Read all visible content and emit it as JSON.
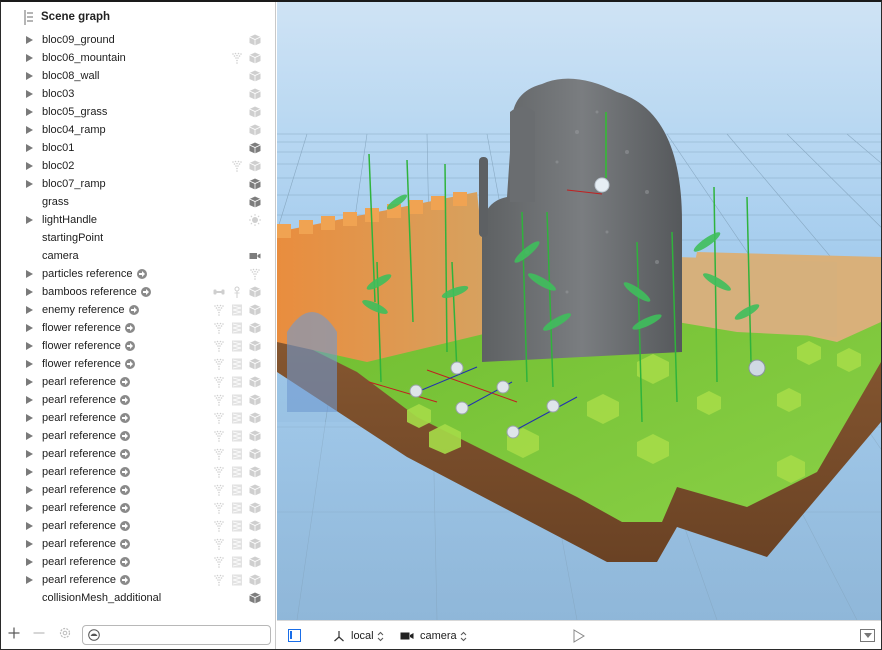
{
  "sidebar": {
    "title": "Scene graph",
    "nodes": [
      {
        "label": "bloc09_ground",
        "expandable": true,
        "reference": false,
        "icons": [
          "geometry-icon"
        ],
        "highlight": false
      },
      {
        "label": "bloc06_mountain",
        "expandable": true,
        "reference": false,
        "icons": [
          "particle-emitter-icon",
          "geometry-icon"
        ],
        "highlight": false
      },
      {
        "label": "bloc08_wall",
        "expandable": true,
        "reference": false,
        "icons": [
          "geometry-icon"
        ],
        "highlight": false
      },
      {
        "label": "bloc03",
        "expandable": true,
        "reference": false,
        "icons": [
          "geometry-icon"
        ],
        "highlight": false
      },
      {
        "label": "bloc05_grass",
        "expandable": true,
        "reference": false,
        "icons": [
          "geometry-icon"
        ],
        "highlight": false
      },
      {
        "label": "bloc04_ramp",
        "expandable": true,
        "reference": false,
        "icons": [
          "geometry-icon"
        ],
        "highlight": false
      },
      {
        "label": "bloc01",
        "expandable": true,
        "reference": false,
        "icons": [
          "geometry-icon"
        ],
        "highlight": true
      },
      {
        "label": "bloc02",
        "expandable": true,
        "reference": false,
        "icons": [
          "particle-emitter-icon",
          "geometry-icon"
        ],
        "highlight": false
      },
      {
        "label": "bloc07_ramp",
        "expandable": true,
        "reference": false,
        "icons": [
          "geometry-icon"
        ],
        "highlight": true
      },
      {
        "label": "grass",
        "expandable": false,
        "reference": false,
        "icons": [
          "geometry-icon"
        ],
        "highlight": true
      },
      {
        "label": "lightHandle",
        "expandable": true,
        "reference": false,
        "icons": [
          "light-icon"
        ],
        "highlight": false
      },
      {
        "label": "startingPoint",
        "expandable": false,
        "reference": false,
        "icons": [],
        "highlight": false
      },
      {
        "label": "camera",
        "expandable": false,
        "reference": false,
        "icons": [
          "camera-icon"
        ],
        "highlight": true
      },
      {
        "label": "particles reference",
        "expandable": true,
        "reference": true,
        "icons": [
          "particle-emitter-icon"
        ],
        "highlight": false
      },
      {
        "label": "bamboos reference",
        "expandable": true,
        "reference": true,
        "icons": [
          "physics-joint-icon",
          "field-icon",
          "geometry-icon"
        ],
        "highlight": false
      },
      {
        "label": "enemy reference",
        "expandable": true,
        "reference": true,
        "icons": [
          "particle-emitter-icon",
          "animation-icon",
          "geometry-icon"
        ],
        "highlight": false
      },
      {
        "label": "flower reference",
        "expandable": true,
        "reference": true,
        "icons": [
          "particle-emitter-icon",
          "animation-icon",
          "geometry-icon"
        ],
        "highlight": false
      },
      {
        "label": "flower reference",
        "expandable": true,
        "reference": true,
        "icons": [
          "particle-emitter-icon",
          "animation-icon",
          "geometry-icon"
        ],
        "highlight": false
      },
      {
        "label": "flower reference",
        "expandable": true,
        "reference": true,
        "icons": [
          "particle-emitter-icon",
          "animation-icon",
          "geometry-icon"
        ],
        "highlight": false
      },
      {
        "label": "pearl reference",
        "expandable": true,
        "reference": true,
        "icons": [
          "particle-emitter-icon",
          "animation-icon",
          "geometry-icon"
        ],
        "highlight": false
      },
      {
        "label": "pearl reference",
        "expandable": true,
        "reference": true,
        "icons": [
          "particle-emitter-icon",
          "animation-icon",
          "geometry-icon"
        ],
        "highlight": false
      },
      {
        "label": "pearl reference",
        "expandable": true,
        "reference": true,
        "icons": [
          "particle-emitter-icon",
          "animation-icon",
          "geometry-icon"
        ],
        "highlight": false
      },
      {
        "label": "pearl reference",
        "expandable": true,
        "reference": true,
        "icons": [
          "particle-emitter-icon",
          "animation-icon",
          "geometry-icon"
        ],
        "highlight": false
      },
      {
        "label": "pearl reference",
        "expandable": true,
        "reference": true,
        "icons": [
          "particle-emitter-icon",
          "animation-icon",
          "geometry-icon"
        ],
        "highlight": false
      },
      {
        "label": "pearl reference",
        "expandable": true,
        "reference": true,
        "icons": [
          "particle-emitter-icon",
          "animation-icon",
          "geometry-icon"
        ],
        "highlight": false
      },
      {
        "label": "pearl reference",
        "expandable": true,
        "reference": true,
        "icons": [
          "particle-emitter-icon",
          "animation-icon",
          "geometry-icon"
        ],
        "highlight": false
      },
      {
        "label": "pearl reference",
        "expandable": true,
        "reference": true,
        "icons": [
          "particle-emitter-icon",
          "animation-icon",
          "geometry-icon"
        ],
        "highlight": false
      },
      {
        "label": "pearl reference",
        "expandable": true,
        "reference": true,
        "icons": [
          "particle-emitter-icon",
          "animation-icon",
          "geometry-icon"
        ],
        "highlight": false
      },
      {
        "label": "pearl reference",
        "expandable": true,
        "reference": true,
        "icons": [
          "particle-emitter-icon",
          "animation-icon",
          "geometry-icon"
        ],
        "highlight": false
      },
      {
        "label": "pearl reference",
        "expandable": true,
        "reference": true,
        "icons": [
          "particle-emitter-icon",
          "animation-icon",
          "geometry-icon"
        ],
        "highlight": false
      },
      {
        "label": "pearl reference",
        "expandable": true,
        "reference": true,
        "icons": [
          "particle-emitter-icon",
          "animation-icon",
          "geometry-icon"
        ],
        "highlight": false
      },
      {
        "label": "collisionMesh_additional",
        "expandable": false,
        "reference": false,
        "icons": [
          "geometry-icon"
        ],
        "highlight": true
      }
    ],
    "filter": {
      "value": "",
      "placeholder": ""
    }
  },
  "toolbar": {
    "coordinate_space": "local",
    "point_of_view": "camera"
  },
  "colors": {
    "accent": "#1a6ee8",
    "icon_light": "#cfcfcf",
    "icon_dark": "#7d7d7d",
    "sky_top": "#a8cfee",
    "grass": "#7ec83a"
  }
}
